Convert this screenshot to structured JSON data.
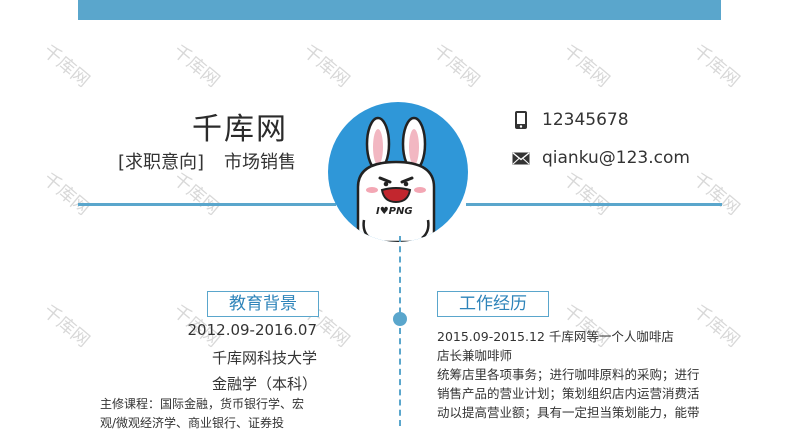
{
  "header": {
    "name": "千库网",
    "intent_label": "[求职意向]",
    "intent_role": "市场销售"
  },
  "contact": {
    "phone": "12345678",
    "email": "qianku@123.com",
    "phone_icon": "phone-icon",
    "email_icon": "envelope-icon"
  },
  "avatar": {
    "badge_text": "I♥PNG",
    "icon": "bunny-mascot"
  },
  "watermark_text": "千库网",
  "education": {
    "title": "教育背景",
    "date": "2012.09-2016.07",
    "school": "千库网科技大学",
    "major": "金融学（本科）",
    "courses": "主修课程：国际金融，货币银行学、宏观/微观经济学、商业银行、证券投"
  },
  "work": {
    "title": "工作经历",
    "date_company": "2015.09-2015.12   千库网等一个人咖啡店",
    "position": "店长兼咖啡师",
    "description": "统筹店里各项事务；进行咖啡原料的采购；进行销售产品的营业计划；策划组织店内运营消费活动以提高营业额；具有一定担当策划能力，能带"
  },
  "colors": {
    "accent": "#5aa6cc",
    "title_text": "#2e84ba",
    "avatar_bg": "#2f97d8"
  }
}
